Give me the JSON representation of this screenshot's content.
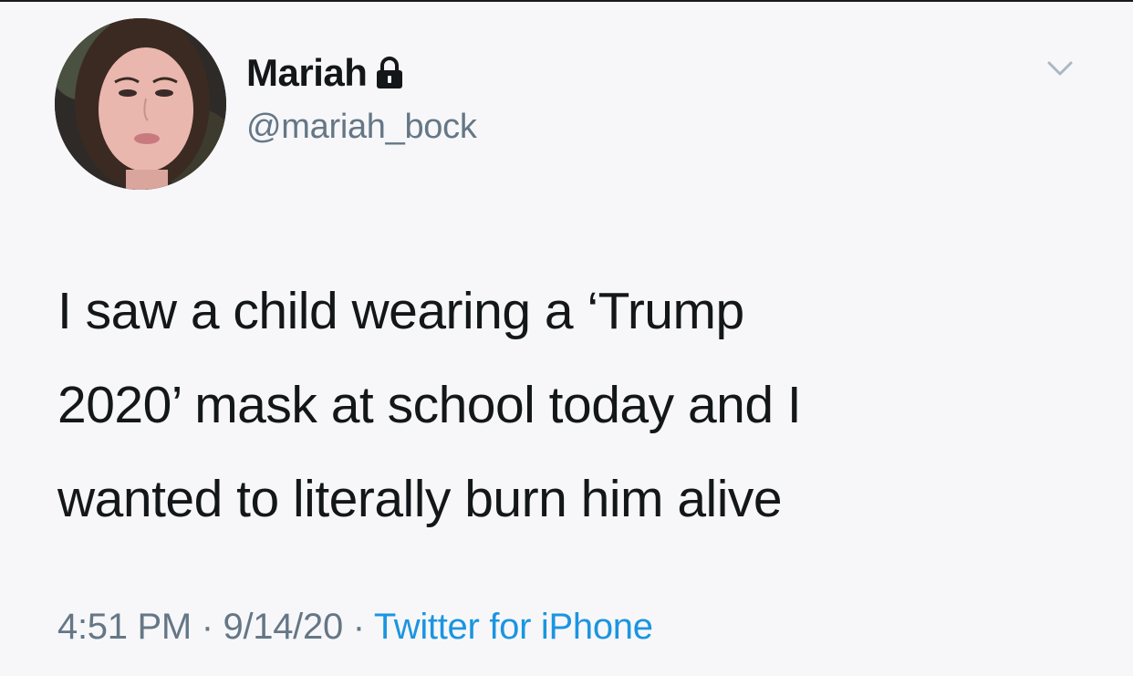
{
  "tweet": {
    "author": {
      "display_name": "Mariah",
      "handle": "@mariah_bock",
      "protected_icon": "lock-icon",
      "avatar_icon": "profile-photo"
    },
    "menu_icon": "chevron-down-icon",
    "text_lines": [
      "I saw a child wearing a ‘Trump",
      "2020’ mask at school today and I",
      "wanted to literally burn him alive"
    ],
    "meta": {
      "time": "4:51 PM",
      "separator": " · ",
      "date": "9/14/20",
      "source": "Twitter for iPhone"
    }
  },
  "colors": {
    "background": "#f7f7f9",
    "text": "#14171a",
    "secondary_text": "#657786",
    "link": "#1b95e0"
  }
}
